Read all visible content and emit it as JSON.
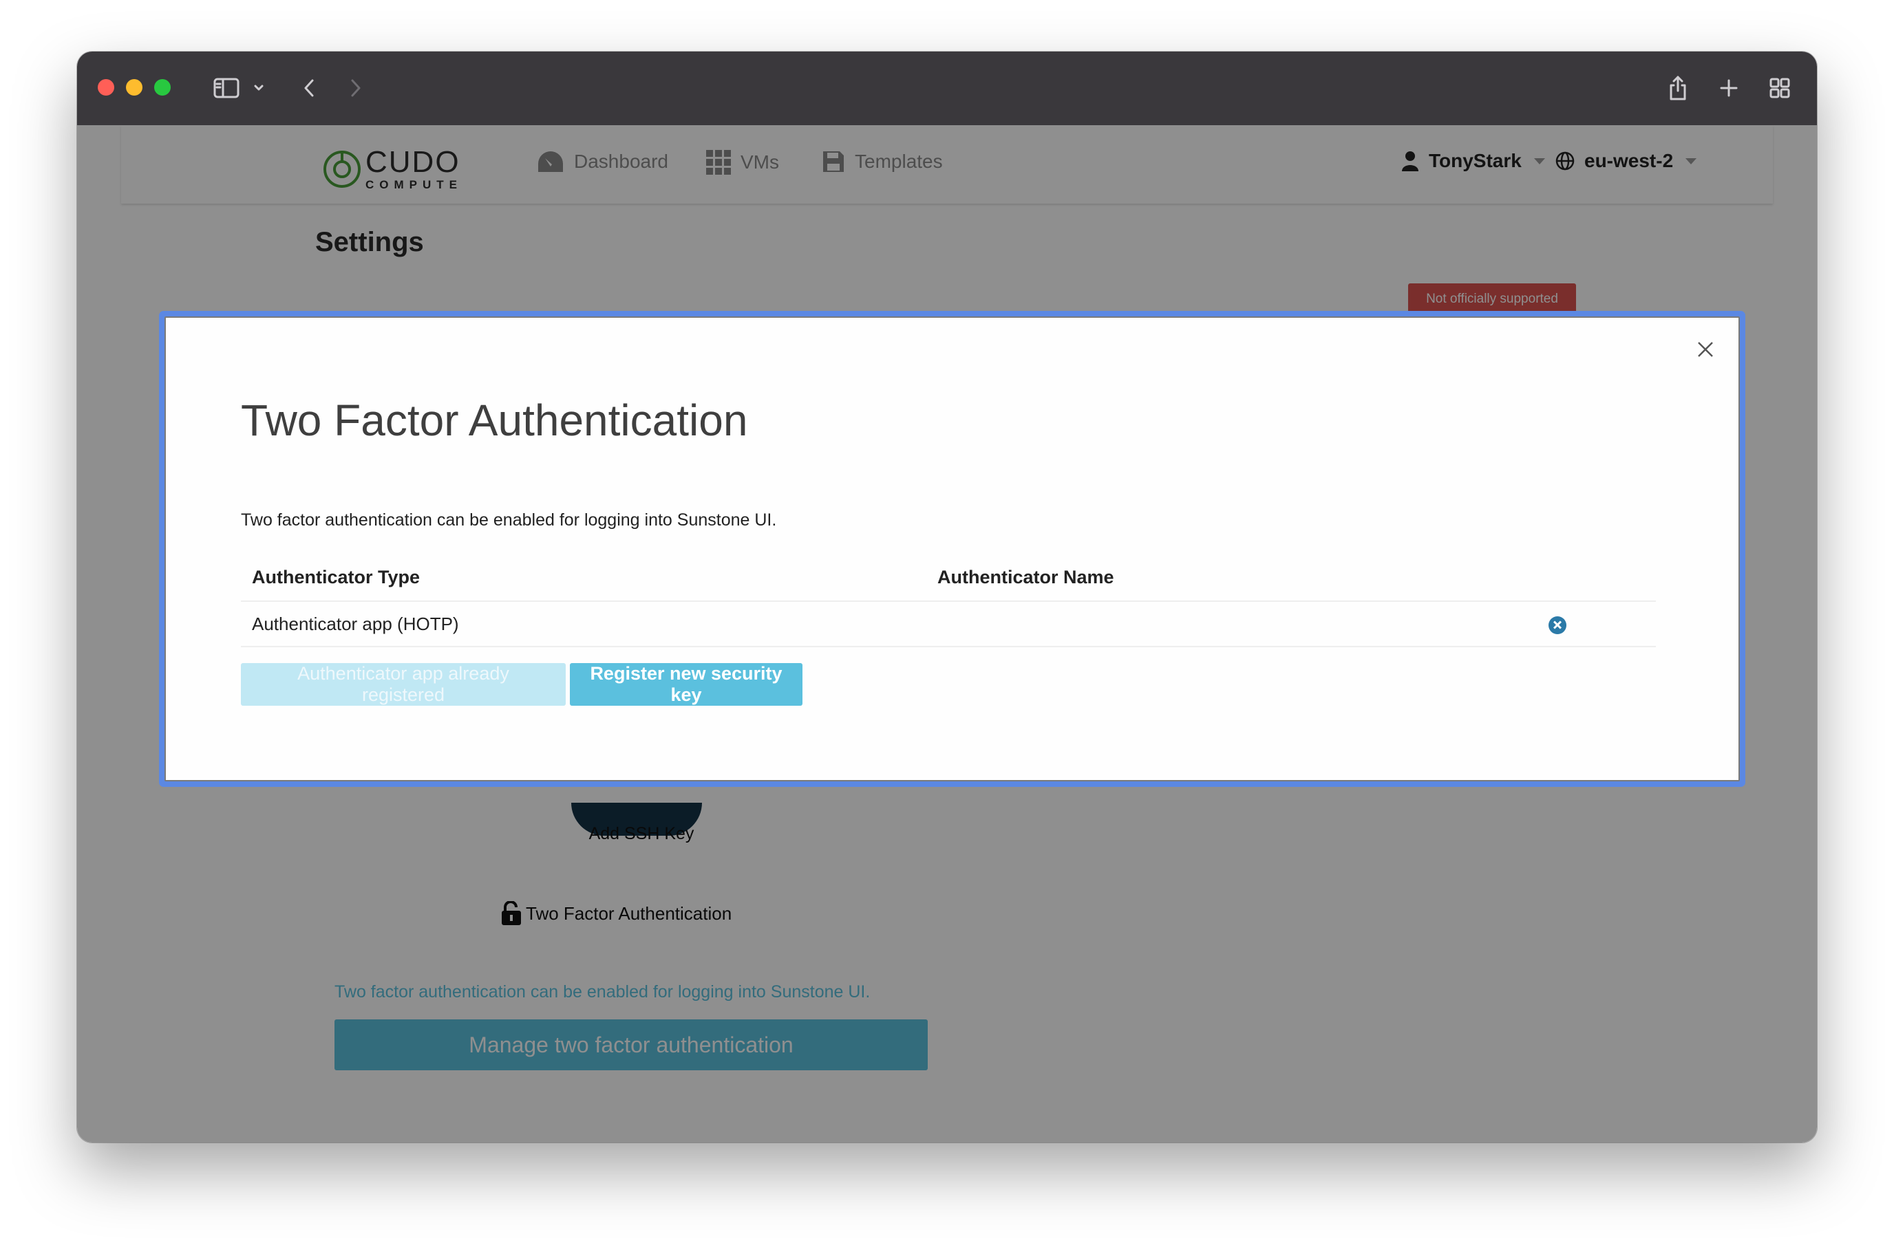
{
  "browser": {
    "traffic_lights": [
      "#ff5f57",
      "#febc2e",
      "#28c840"
    ],
    "icons": [
      "sidebar-icon",
      "chevron-down-icon",
      "back-icon",
      "forward-icon",
      "share-icon",
      "new-tab-icon",
      "tab-overview-icon"
    ]
  },
  "appbar": {
    "logo": {
      "brand": "CUDO",
      "sub": "COMPUTE"
    },
    "nav": [
      {
        "label": "Dashboard",
        "icon": "gauge-icon"
      },
      {
        "label": "VMs",
        "icon": "grid-icon"
      },
      {
        "label": "Templates",
        "icon": "floppy-icon"
      }
    ],
    "user": {
      "label": "TonyStark",
      "icon": "user-icon"
    },
    "region": {
      "label": "eu-west-2",
      "icon": "globe-icon"
    }
  },
  "page": {
    "title": "Settings",
    "badge": "Not officially supported",
    "ssh": {
      "label": "Add SSH Key"
    },
    "tfa": {
      "heading": "Two Factor Authentication",
      "description": "Two factor authentication can be enabled for logging into Sunstone UI.",
      "manage_button": "Manage two factor authentication"
    }
  },
  "modal": {
    "title": "Two Factor Authentication",
    "description": "Two factor authentication can be enabled for logging into Sunstone UI.",
    "table": {
      "columns": [
        "Authenticator Type",
        "Authenticator Name"
      ],
      "rows": [
        {
          "type": "Authenticator app (HOTP)",
          "name": ""
        }
      ]
    },
    "buttons": {
      "registered": "Authenticator app already registered",
      "register_key": "Register new security key"
    },
    "colors": {
      "primary": "#5bc0de",
      "focus_ring": "#5b88e3",
      "danger": "#d9534f"
    }
  }
}
